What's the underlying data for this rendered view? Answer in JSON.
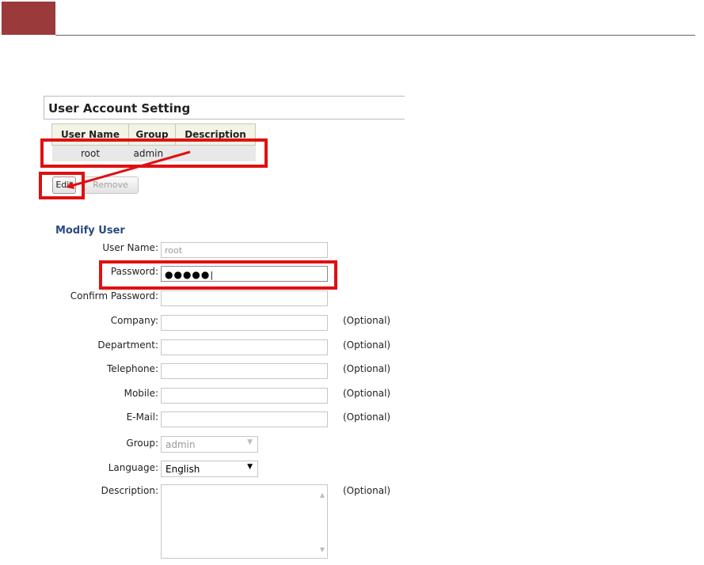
{
  "account": {
    "title": "User Account Setting",
    "columns": [
      "User Name",
      "Group",
      "Description"
    ],
    "rows": [
      {
        "name": "root",
        "group": "admin",
        "description": ""
      }
    ],
    "edit_label": "Edit",
    "remove_label": "Remove"
  },
  "modify": {
    "title": "Modify User",
    "fields": {
      "username": {
        "label": "User Name:",
        "value": "root"
      },
      "password": {
        "label": "Password:",
        "value": "●●●●●"
      },
      "confirm": {
        "label": "Confirm Password:"
      },
      "company": {
        "label": "Company:"
      },
      "department": {
        "label": "Department:"
      },
      "telephone": {
        "label": "Telephone:"
      },
      "mobile": {
        "label": "Mobile:"
      },
      "email": {
        "label": "E-Mail:"
      },
      "group": {
        "label": "Group:",
        "value": "admin"
      },
      "language": {
        "label": "Language:",
        "value": "English"
      },
      "description": {
        "label": "Description:"
      }
    },
    "optional_label": "(Optional)"
  },
  "colors": {
    "accent_block": "#9b3a3a",
    "highlight": "#e01010",
    "title_blue": "#2a4a80"
  }
}
